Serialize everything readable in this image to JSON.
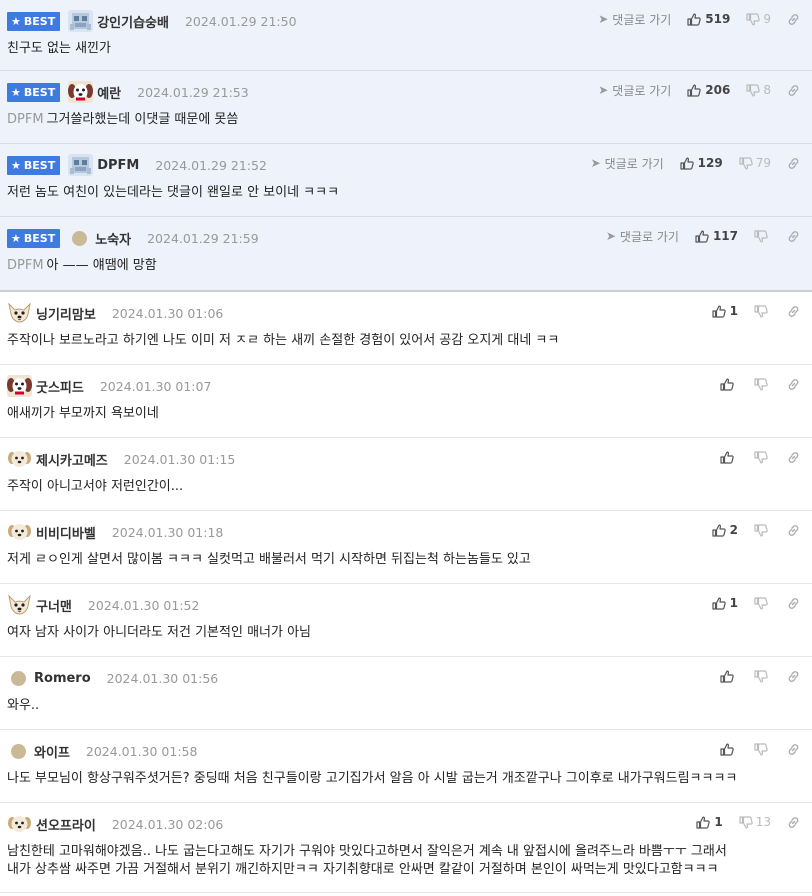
{
  "best_badge": "BEST",
  "reply_link_label": "댓글로 가기",
  "best_comments": [
    {
      "nick": "강인기습숭배",
      "date": "2024.01.29 21:50",
      "likes": "519",
      "dislikes": "9",
      "text": "친구도 없는 새낀가",
      "tag": "",
      "avatar": "pixel-face"
    },
    {
      "nick": "예란",
      "date": "2024.01.29 21:53",
      "likes": "206",
      "dislikes": "8",
      "text": "그거쓸라했는데 이댓글 때문에 못씀",
      "tag": "DPFM",
      "avatar": "dog-face"
    },
    {
      "nick": "DPFM",
      "date": "2024.01.29 21:52",
      "likes": "129",
      "dislikes": "79",
      "text": "저런 놈도 여친이 있는데라는 댓글이 왠일로 안 보이네 ㅋㅋㅋ",
      "tag": "",
      "avatar": "pixel-face"
    },
    {
      "nick": "노숙자",
      "date": "2024.01.29 21:59",
      "likes": "117",
      "dislikes": "",
      "text": "아 —— 얘땜에 망함",
      "tag": "DPFM",
      "avatar": "dot"
    }
  ],
  "comments": [
    {
      "nick": "닝기리맘보",
      "date": "2024.01.30 01:06",
      "likes": "1",
      "dislikes": "",
      "lines": [
        "주작이나 보르노라고 하기엔 나도 이미 저 ㅈㄹ 하는 새끼 손절한 경험이 있어서 공감 오지게 대네 ㅋㅋ"
      ],
      "avatar": "chihuahua"
    },
    {
      "nick": "굿스피드",
      "date": "2024.01.30 01:07",
      "likes": "",
      "dislikes": "",
      "lines": [
        "애새끼가 부모까지 욕보이네"
      ],
      "avatar": "dog-face"
    },
    {
      "nick": "제시카고메즈",
      "date": "2024.01.30 01:15",
      "likes": "",
      "dislikes": "",
      "lines": [
        "주작이 아니고서야 저런인간이..."
      ],
      "avatar": "puppy"
    },
    {
      "nick": "비비디바벨",
      "date": "2024.01.30 01:18",
      "likes": "2",
      "dislikes": "",
      "lines": [
        "저게 ㄹㅇ인게 살면서 많이봄 ㅋㅋㅋ 실컷먹고 배불러서 먹기 시작하면 뒤집는척 하는놈들도 있고"
      ],
      "avatar": "puppy"
    },
    {
      "nick": "구너맨",
      "date": "2024.01.30 01:52",
      "likes": "1",
      "dislikes": "",
      "lines": [
        "여자 남자 사이가 아니더라도 저건 기본적인 매너가 아님"
      ],
      "avatar": "chihuahua"
    },
    {
      "nick": "Romero",
      "date": "2024.01.30 01:56",
      "likes": "",
      "dislikes": "",
      "lines": [
        "와우.."
      ],
      "avatar": "dot"
    },
    {
      "nick": "와이프",
      "date": "2024.01.30 01:58",
      "likes": "",
      "dislikes": "",
      "lines": [
        "나도 부모님이 항상구워주셧거든? 중딩때 처음 친구들이랑 고기집가서 알음 아 시발 굽는거 개조깥구나 그이후로 내가구워드림ㅋㅋㅋㅋ"
      ],
      "avatar": "dot"
    },
    {
      "nick": "션오프라이",
      "date": "2024.01.30 02:06",
      "likes": "1",
      "dislikes": "13",
      "lines": [
        "남친한테 고마워해야겠음.. 나도 굽는다고해도 자기가 구워야 맛있다고하면서 잘익은거 계속 내 앞접시에 올려주느라 바쁨ㅜㅜ 그래서",
        "내가 상추쌈 싸주면 가끔 거절해서 분위기 깨긴하지만ㅋㅋ 자기취향대로 안싸면 칼같이 거절하며 본인이 싸먹는게 맛있다고함ㅋㅋㅋ"
      ],
      "avatar": "puppy"
    }
  ],
  "colors": {
    "best_badge": "#3d7be0",
    "best_bg": "#eef2fb",
    "muted": "#999999"
  },
  "icons": {
    "like": "thumbs-up-icon",
    "dislike": "thumbs-down-icon",
    "share": "link-icon",
    "reply": "arrow-icon",
    "best": "star-icon"
  }
}
